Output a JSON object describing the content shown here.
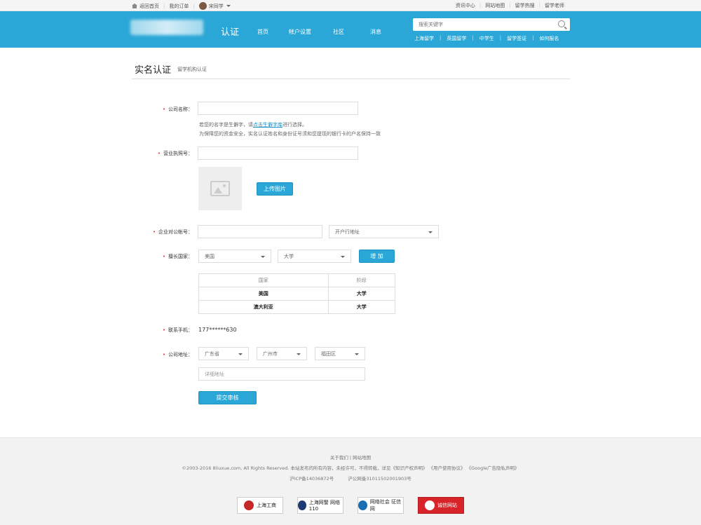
{
  "topbar": {
    "back_home": "返回首页",
    "my_orders": "我的订单",
    "username": "宋同学",
    "right_links": [
      "资讯中心",
      "网站地图",
      "留学热搜",
      "留学老师"
    ]
  },
  "header": {
    "section": "认证",
    "nav": [
      "首页",
      "帐户设置",
      "社区",
      "消息"
    ],
    "search_placeholder": "搜索关键字",
    "quick_links": [
      "上海留学",
      "英国留学",
      "中学生",
      "留学签证",
      "如何报名"
    ]
  },
  "page": {
    "title": "实名认证",
    "subtitle": "留学机构认证"
  },
  "form": {
    "company_name_label": "公司名称：",
    "hint1_pre": "若您的名字是生僻字，请",
    "hint1_link": "点击生僻字库",
    "hint1_post": "进行选择。",
    "hint2": "为保障您的资金安全，实名认证姓名和身份证号须和您提现的银行卡的户名保持一致",
    "license_label": "营业执照号：",
    "upload_button": "上传图片",
    "account_label": "企业对公帐号：",
    "bank_placeholder": "开户行地址",
    "country_label": "擅长国家：",
    "country_value": "美国",
    "stage_value": "大学",
    "add_button": "增 加",
    "table_headers": [
      "国家",
      "阶段"
    ],
    "table_rows": [
      {
        "country": "美国",
        "stage": "大学"
      },
      {
        "country": "澳大利亚",
        "stage": "大学"
      }
    ],
    "phone_label": "联系手机：",
    "phone_value": "177******630",
    "address_label": "公司地址：",
    "province": "广东省",
    "city": "广州市",
    "district": "福田区",
    "detail_placeholder": "详细地址",
    "submit_button": "提交审核"
  },
  "footer": {
    "links": "关于我们 | 网站地图",
    "copyright": "©2003-2016 8liuxue.com, All Rights Reserved.   本站发布的所有内容，未经许可，不得转载，详见《知识产权声明》 《用户使用协议》 《Google广告隐私声明》",
    "icp": "沪ICP备14036872号",
    "police": "沪公网备31011502001903号",
    "badges": [
      "上海工商",
      "上海网警 网络110",
      "网络社会 征信网",
      "诚信网站"
    ]
  },
  "colors": {
    "brand": "#2aa7d7",
    "required": "#e33333"
  }
}
